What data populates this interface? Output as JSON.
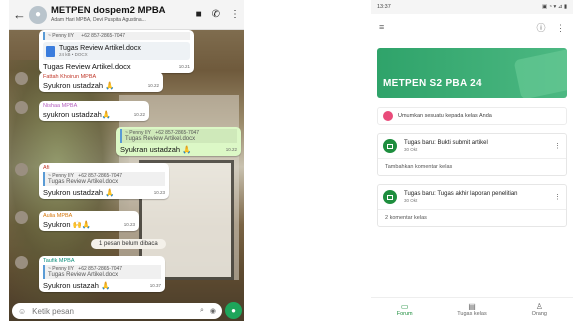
{
  "whatsapp": {
    "back_glyph": "←",
    "title": "METPEN dospem2 MPBA",
    "members": "Adam Hari MPBA, Devi Puspita Agustina...",
    "video_glyph": "■",
    "call_glyph": "✆",
    "menu_glyph": "⋮",
    "messages": [
      {
        "sender": "~ Penny IIY",
        "phone": "+62 857-2865-7047",
        "doc_name": "Tugas Review Artikel.docx",
        "doc_size": "24 kB • DOCX",
        "text": "Tugas Review Artikel.docx",
        "time": "10.21"
      },
      {
        "sender": "Fattah Khoirun MPBA",
        "text": "Syukron ustadzah 🙏",
        "time": "10.22"
      },
      {
        "sender": "Nishaa MPBA",
        "text": "syukron ustadzah🙏",
        "time": "10.22"
      },
      {
        "quote_sender": "~ Penny IIY",
        "quote_phone": "+62 857-2865-7047",
        "quote_file": "Tugas Review Artikel.docx",
        "text": "Syukran ustadzah 🙏",
        "time": "10.22"
      },
      {
        "sender": "Afi",
        "quote_sender": "~ Penny IIY",
        "quote_phone": "+62 857-2865-7047",
        "quote_file": "Tugas Review Artikel.docx",
        "text": "Syukron ustadzah 🙏",
        "time": "10.23"
      },
      {
        "sender": "Aulia MPBA",
        "text": "Syukron 🙌🙏",
        "time": "10.23"
      },
      {
        "sender": "Taufik MPBA",
        "quote_sender": "~ Penny IIY",
        "quote_phone": "+62 857-2865-7047",
        "quote_file": "Tugas Review Artikel.docx",
        "text": "Syukron ustazah 🙏",
        "time": "10.37"
      }
    ],
    "system_note": "1 pesan belum dibaca",
    "input_placeholder": "Ketik pesan",
    "emoji_glyph": "☺",
    "attach_glyph": "⌕",
    "camera_glyph": "◉",
    "mic_glyph": "●"
  },
  "classroom": {
    "status_time": "13:37",
    "status_right": "▣ ◔ ▾ ⊿ ▮",
    "menu_glyph": "≡",
    "info_glyph": "ⓘ",
    "more_glyph": "⋮",
    "class_name": "METPEN S2 PBA 24",
    "share_text": "Umumkan sesuatu kepada kelas Anda",
    "posts": [
      {
        "title": "Tugas baru: Bukti submit artikel",
        "date": "30 Okt",
        "comment": "Tambahkan komentar kelas"
      },
      {
        "title": "Tugas baru: Tugas akhir laporan penelitian",
        "date": "30 Okt",
        "comment": "2 komentar kelas"
      }
    ],
    "nav": [
      {
        "label": "Forum",
        "glyph": "▭"
      },
      {
        "label": "Tugas kelas",
        "glyph": "▤"
      },
      {
        "label": "Orang",
        "glyph": "♙"
      }
    ]
  }
}
